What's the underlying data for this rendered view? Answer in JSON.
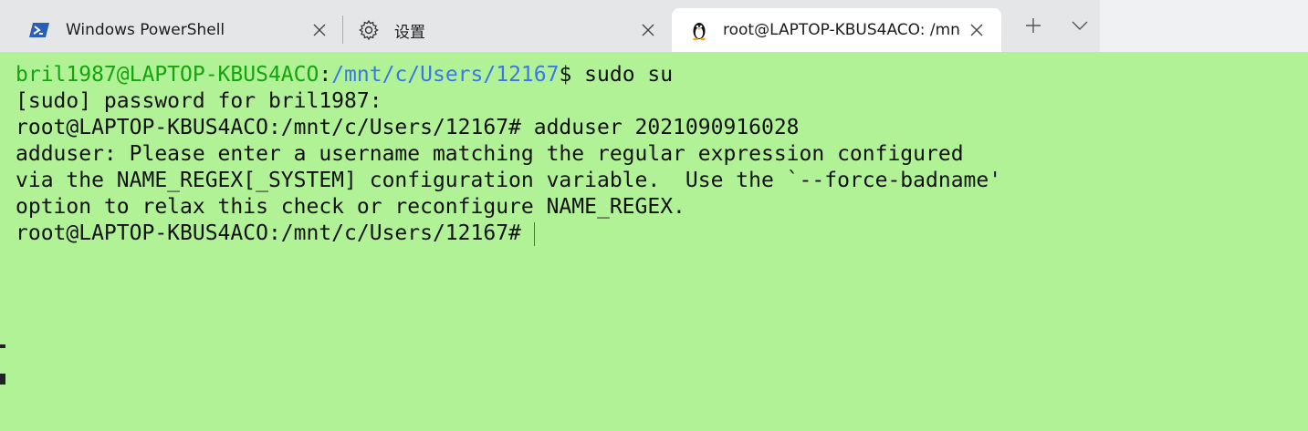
{
  "tabs": [
    {
      "label": "Windows PowerShell",
      "icon": "powershell-icon",
      "active": false
    },
    {
      "label": "设置",
      "icon": "gear-icon",
      "active": false
    },
    {
      "label": "root@LAPTOP-KBUS4ACO: /mn",
      "icon": "linux-penguin-icon",
      "active": true
    }
  ],
  "tab_controls": {
    "new_tab": "+",
    "dropdown": "⌄"
  },
  "terminal": {
    "background": "#b1f296",
    "prompt_user_color": "#16a30f",
    "prompt_path_color": "#3b78e7",
    "line1": {
      "user": "bril1987@LAPTOP-KBUS4ACO",
      "sep": ":",
      "path": "/mnt/c/Users/12167",
      "cmd": "$ sudo su"
    },
    "lines": [
      "[sudo] password for bril1987:",
      "root@LAPTOP-KBUS4ACO:/mnt/c/Users/12167# adduser 2021090916028",
      "adduser: Please enter a username matching the regular expression configured",
      "via the NAME_REGEX[_SYSTEM] configuration variable.  Use the `--force-badname'",
      "option to relax this check or reconfigure NAME_REGEX.",
      "root@LAPTOP-KBUS4ACO:/mnt/c/Users/12167#"
    ]
  }
}
